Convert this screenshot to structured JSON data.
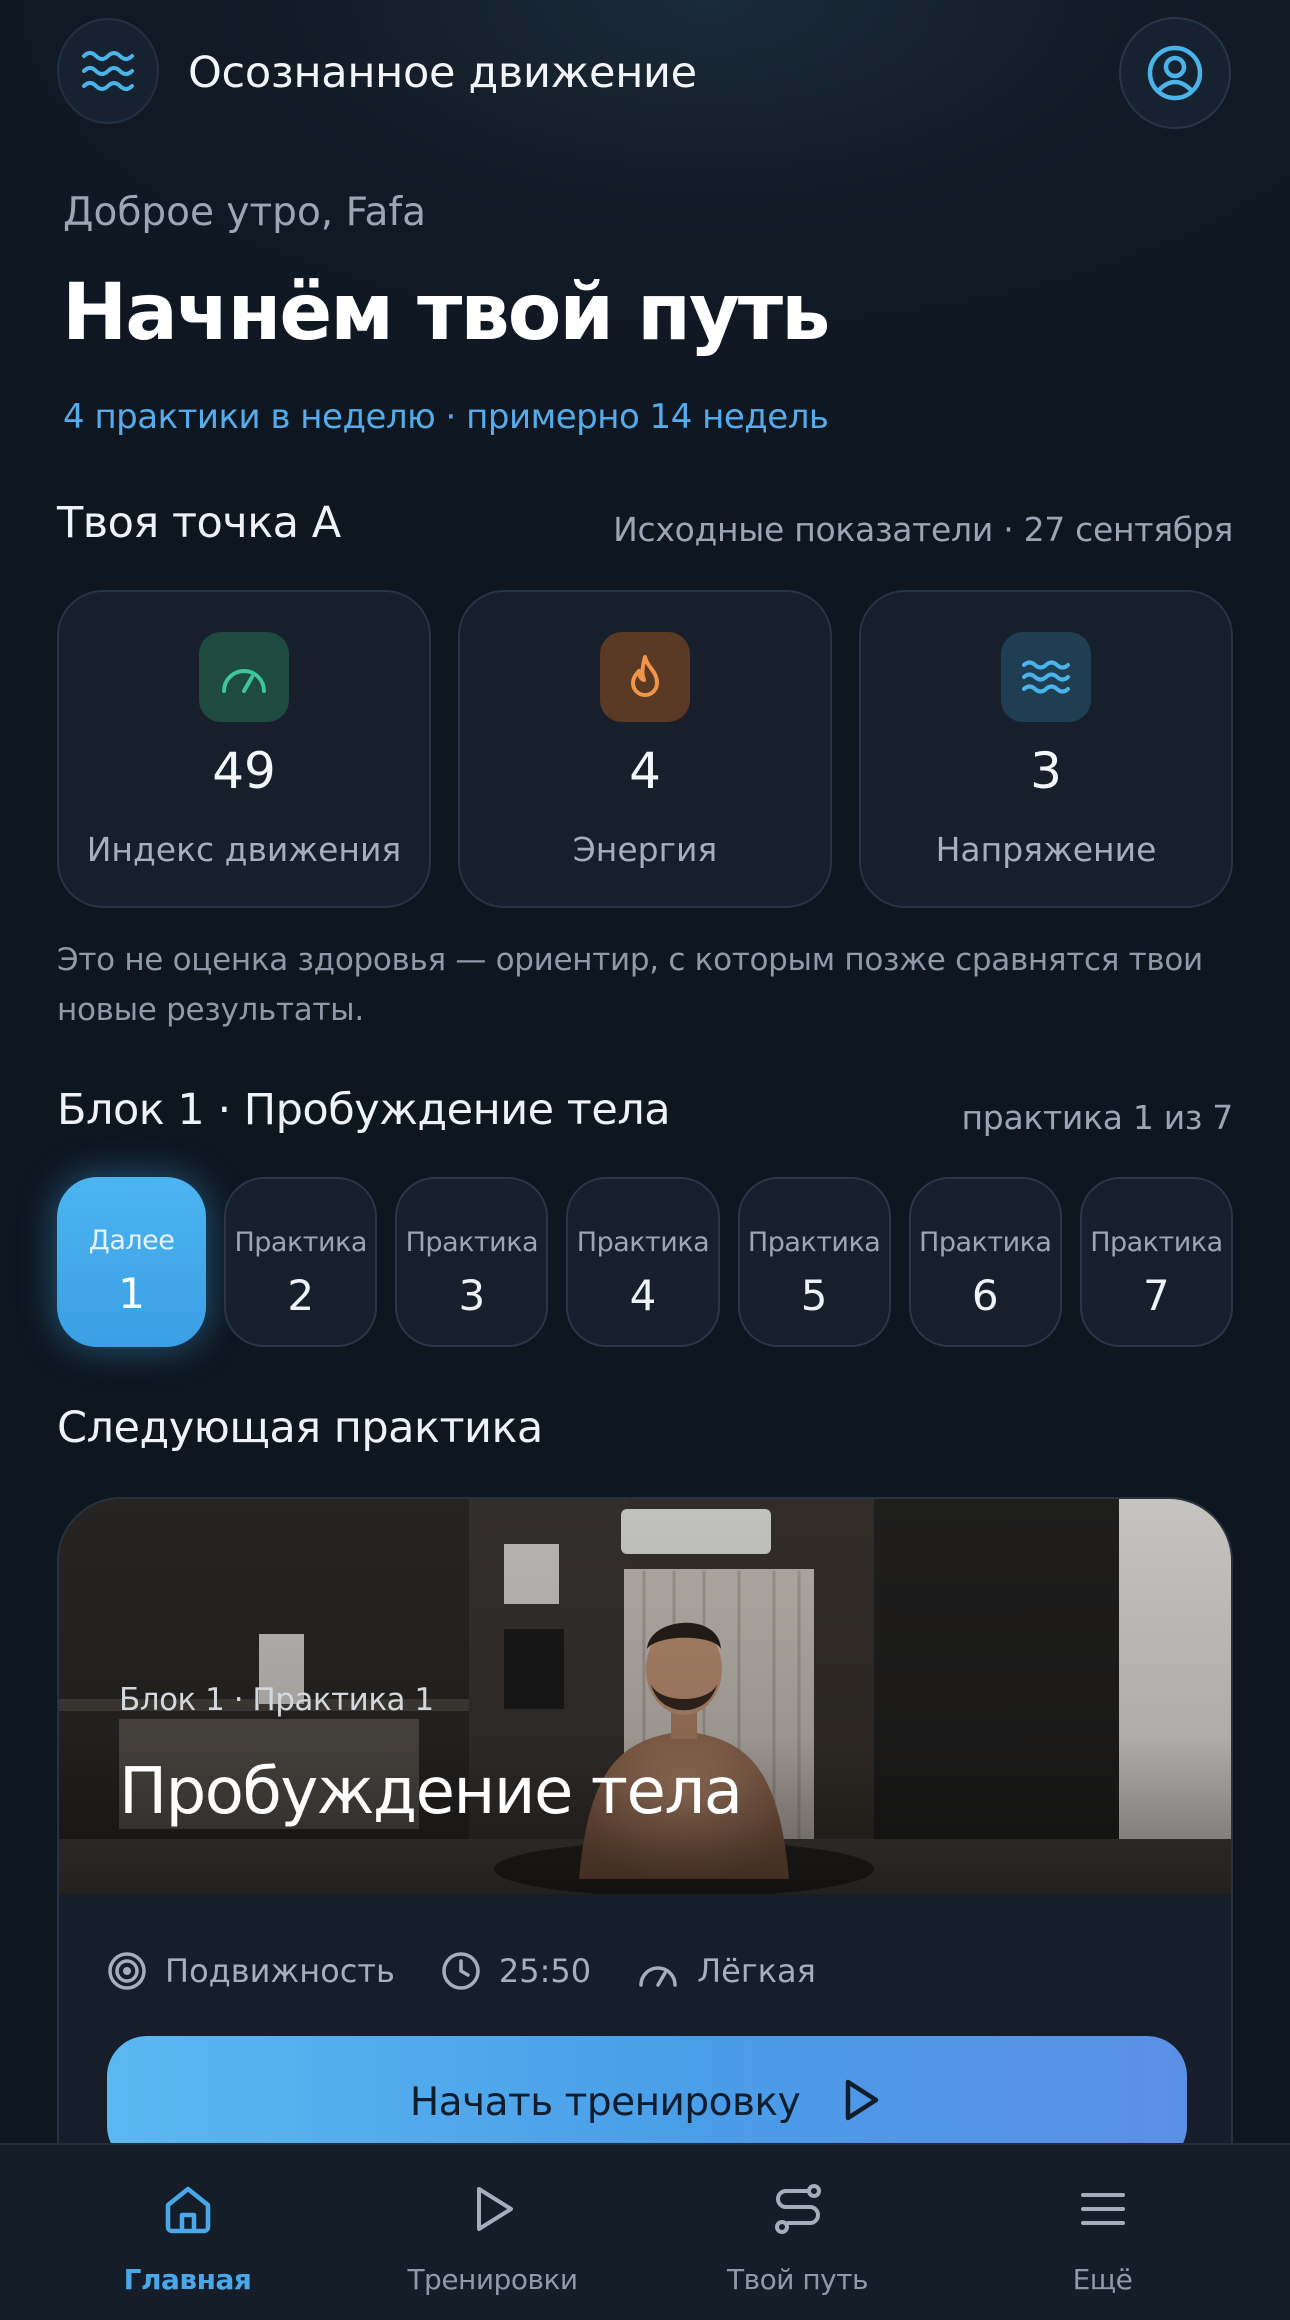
{
  "header": {
    "app_title": "Осознанное движение",
    "menu_icon": "waves-icon",
    "profile_icon": "user-circle-icon"
  },
  "hero": {
    "greeting": "Доброе утро, Fafa",
    "title": "Начнём твой путь",
    "plan": "4 практики в неделю · примерно 14 недель"
  },
  "point_a": {
    "title": "Твоя точка А",
    "meta": "Исходные показатели · 27 сентября",
    "metrics": [
      {
        "icon": "speedometer-icon",
        "value": "49",
        "label": "Индекс движения",
        "color": "#3fc59a"
      },
      {
        "icon": "flame-icon",
        "value": "4",
        "label": "Энергия",
        "color": "#f0964a"
      },
      {
        "icon": "waves-icon",
        "value": "3",
        "label": "Напряжение",
        "color": "#4ab4ea"
      }
    ],
    "disclaimer": "Это не оценка здоровья — ориентир, с которым позже сравнятся твои новые результаты."
  },
  "block": {
    "title": "Блок 1 · Пробуждение тела",
    "progress": "практика 1 из 7",
    "practices": [
      {
        "label": "Далее",
        "num": "1",
        "active": true
      },
      {
        "label": "Практика",
        "num": "2"
      },
      {
        "label": "Практика",
        "num": "3"
      },
      {
        "label": "Практика",
        "num": "4"
      },
      {
        "label": "Практика",
        "num": "5"
      },
      {
        "label": "Практика",
        "num": "6"
      },
      {
        "label": "Практика",
        "num": "7"
      }
    ]
  },
  "next": {
    "section_title": "Следующая практика",
    "subtitle": "Блок 1 · Практика 1",
    "title": "Пробуждение тела",
    "tags": [
      {
        "icon": "target-icon",
        "label": "Подвижность"
      },
      {
        "icon": "clock-icon",
        "label": "25:50"
      },
      {
        "icon": "gauge-icon",
        "label": "Лёгкая"
      }
    ],
    "start_label": "Начать тренировку"
  },
  "nav": {
    "items": [
      {
        "icon": "home-icon",
        "label": "Главная",
        "active": true
      },
      {
        "icon": "play-icon",
        "label": "Тренировки"
      },
      {
        "icon": "route-icon",
        "label": "Твой путь"
      },
      {
        "icon": "menu-icon",
        "label": "Ещё"
      }
    ]
  },
  "colors": {
    "accent": "#4aa8ea",
    "background": "#0e1620",
    "card": "#161f2b"
  }
}
